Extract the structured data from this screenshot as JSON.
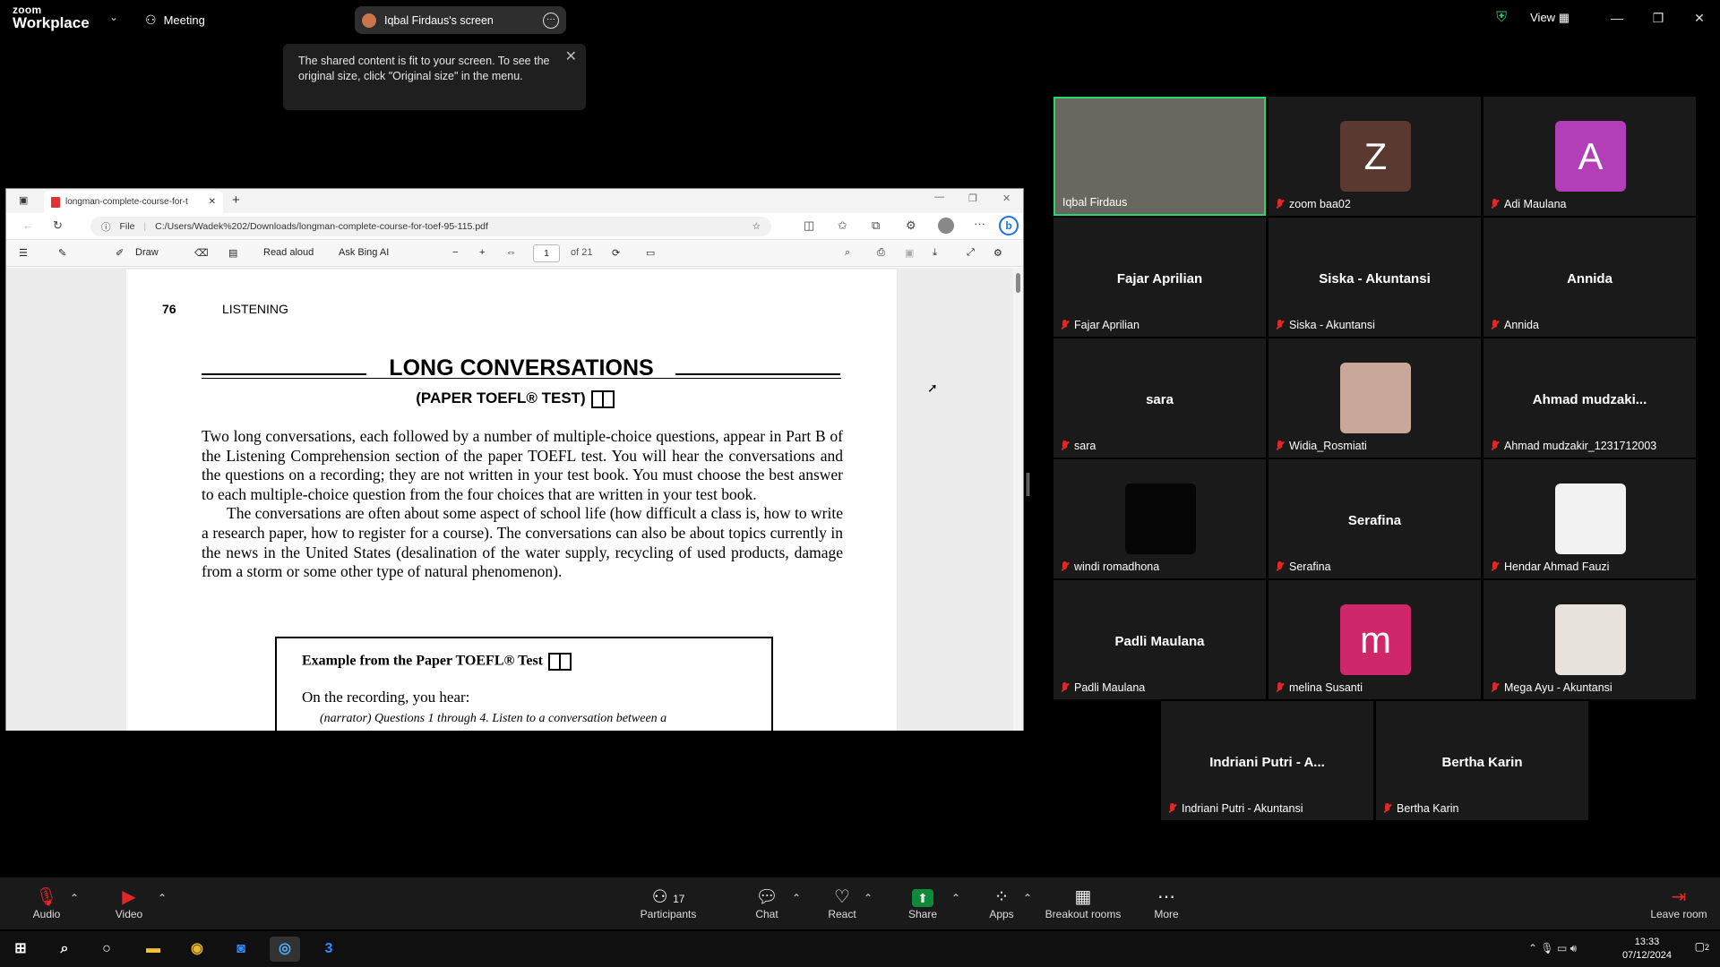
{
  "app": {
    "logo_small": "zoom",
    "logo_big": "Workplace",
    "meeting_label": "Meeting"
  },
  "share": {
    "pill_label": "Iqbal Firdaus's screen",
    "view_label": "View"
  },
  "tooltip": {
    "text": "The shared content is fit to your screen. To see the original size, click \"Original size\" in the menu."
  },
  "browser": {
    "tab_title": "longman-complete-course-for-t",
    "file_label": "File",
    "url": "C:/Users/Wadek%202/Downloads/longman-complete-course-for-toef-95-115.pdf",
    "draw_label": "Draw",
    "read_aloud_label": "Read aloud",
    "ask_bing_label": "Ask Bing AI",
    "page_current": "1",
    "page_total": "of 21"
  },
  "pdf": {
    "page_number": "76",
    "section": "LISTENING",
    "title": "LONG CONVERSATIONS",
    "subtitle": "(PAPER TOEFL® TEST)",
    "para1": "Two long conversations, each followed by a number of multiple-choice questions, appear in Part B of the Listening Comprehension section of the paper TOEFL test. You will hear the conversations and the questions on a recording; they are not written in your test book. You must choose the best answer to each multiple-choice question from the four choices that are written in your test book.",
    "para2": "The conversations are often about some aspect of school life (how difficult a class is, how to write a research paper, how to register for a course). The conversations can also be about topics currently in the news in the United States (desalination of the water supply, recycling of used products, damage from a storm or some other type of natural phenomenon).",
    "example_title": "Example from the Paper TOEFL® Test",
    "example_line1": "On the recording, you hear:",
    "example_line2": "(narrator)   Questions 1 through 4. Listen to a conversation between a"
  },
  "participants": [
    {
      "tile": "Iqbal Firdaus",
      "big": "",
      "avatar": ""
    },
    {
      "tile": "zoom baa02",
      "big": "",
      "avatar": "Z",
      "color": "#5a3a30"
    },
    {
      "tile": "Adi Maulana",
      "big": "",
      "avatar": "A",
      "color": "#b33fb8"
    },
    {
      "tile": "Fajar Aprilian",
      "big": "Fajar Aprilian",
      "avatar": ""
    },
    {
      "tile": "Siska - Akuntansi",
      "big": "Siska - Akuntansi",
      "avatar": ""
    },
    {
      "tile": "Annida",
      "big": "Annida",
      "avatar": ""
    },
    {
      "tile": "sara",
      "big": "sara",
      "avatar": ""
    },
    {
      "tile": "Widia_Rosmiati",
      "big": "",
      "avatar": ""
    },
    {
      "tile": "Ahmad mudzakir_1231712003",
      "big": "Ahmad  mudzaki...",
      "avatar": ""
    },
    {
      "tile": "windi romadhona",
      "big": "",
      "avatar": ""
    },
    {
      "tile": "Serafina",
      "big": "Serafina",
      "avatar": ""
    },
    {
      "tile": "Hendar Ahmad Fauzi",
      "big": "",
      "avatar": ""
    },
    {
      "tile": "Padli Maulana",
      "big": "Padli Maulana",
      "avatar": ""
    },
    {
      "tile": "melina Susanti",
      "big": "",
      "avatar": "m",
      "color": "#d0276a"
    },
    {
      "tile": "Mega Ayu - Akuntansi",
      "big": "",
      "avatar": ""
    },
    {
      "tile": "Indriani Putri - Akuntansi",
      "big": "Indriani Putri - A...",
      "avatar": ""
    },
    {
      "tile": "Bertha Karin",
      "big": "Bertha Karin",
      "avatar": ""
    }
  ],
  "toolbar": {
    "audio": "Audio",
    "video": "Video",
    "participants": "Participants",
    "participants_count": "17",
    "chat": "Chat",
    "react": "React",
    "share": "Share",
    "apps": "Apps",
    "breakout": "Breakout rooms",
    "more": "More",
    "leave": "Leave room",
    "share_color": "#0e8a3a"
  },
  "taskbar": {
    "time": "13:33",
    "date": "07/12/2024",
    "notif": "2"
  }
}
